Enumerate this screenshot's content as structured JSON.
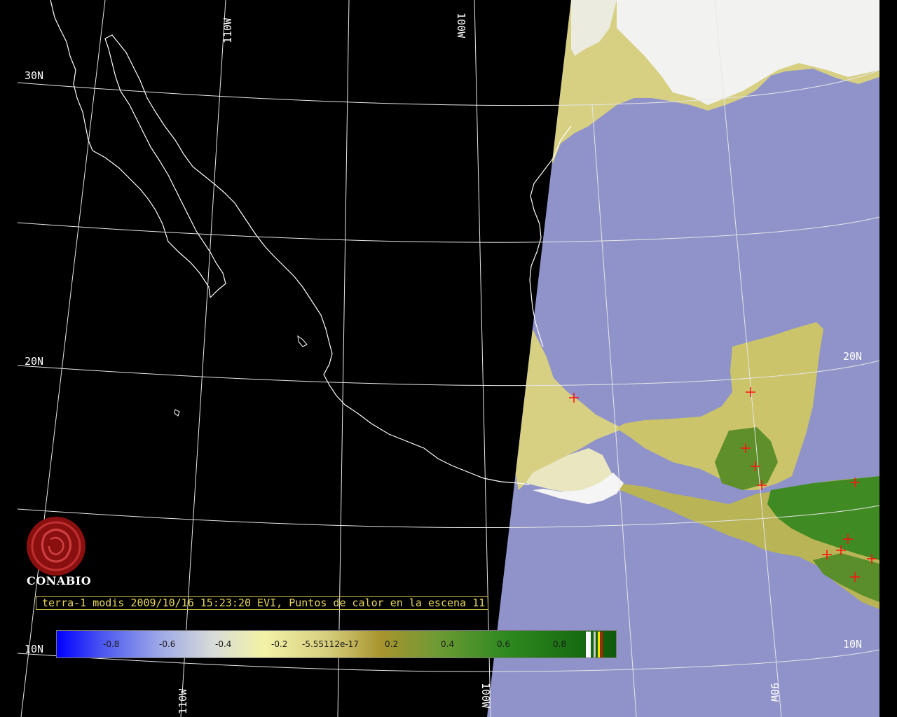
{
  "graticule": {
    "lat_labels": [
      "30N",
      "20N",
      "10N",
      "20N",
      "10N"
    ],
    "lon_labels": [
      "110W",
      "100W",
      "110W",
      "100W",
      "90W"
    ]
  },
  "branding": {
    "logo_text": "CONABIO",
    "logo_icon": "conabio-logo-icon"
  },
  "caption": "terra-1 modis 2009/10/16 15:23:20 EVI, Puntos de calor en la escena 11",
  "colorbar": {
    "ticks": [
      "-0.8",
      "-0.6",
      "-0.4",
      "-0.2",
      "-5.55112e-17",
      "0.2",
      "0.4",
      "0.6",
      "0.8"
    ],
    "stripe_colors": [
      "#ffffff",
      "#c8c8c8",
      "#f2e600",
      "#cc1a00"
    ]
  },
  "colors": {
    "ocean": "#8f93c9",
    "coast": "#ffffff",
    "grid": "#e6e6e6",
    "land_yellow": "#d8cf7a",
    "land_green": "#3e8a22",
    "hotspot": "#ff1010"
  },
  "hotspots_count": 11
}
